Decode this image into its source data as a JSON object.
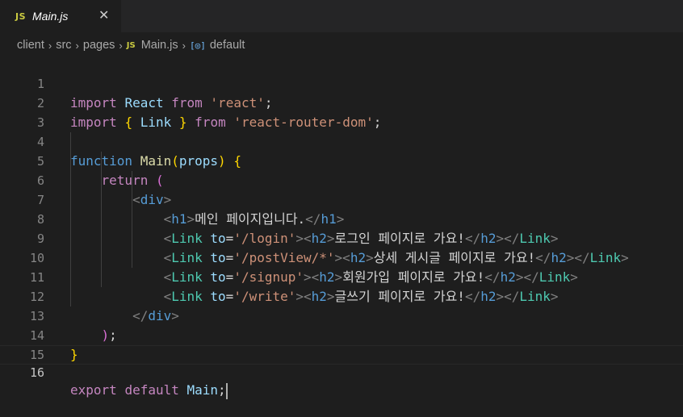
{
  "tab": {
    "badge": "JS",
    "title": "Main.js",
    "close": "✕"
  },
  "breadcrumb": {
    "items": [
      "client",
      "src",
      "pages"
    ],
    "file_badge": "JS",
    "file": "Main.js",
    "symbol_icon": "[◎]",
    "symbol": "default",
    "separator": "›"
  },
  "line_numbers": [
    "1",
    "2",
    "3",
    "4",
    "5",
    "6",
    "7",
    "8",
    "9",
    "10",
    "11",
    "12",
    "13",
    "14",
    "15",
    "16"
  ],
  "code": {
    "l1": {
      "kw": "import",
      "id": "React",
      "from": "from",
      "str": "'react'",
      "end": ";"
    },
    "l2": {
      "kw": "import",
      "ob": "{",
      "id": "Link",
      "cb": "}",
      "from": "from",
      "str": "'react-router-dom'",
      "end": ";"
    },
    "l4": {
      "kw": "function",
      "name": "Main",
      "op": "(",
      "param": "props",
      "cp": ")",
      "brace": "{"
    },
    "l5": {
      "kw": "return",
      "paren": "("
    },
    "l6": {
      "lt": "<",
      "tag": "div",
      "gt": ">"
    },
    "l7": {
      "open": "h1",
      "text": "메인 페이지입니다.",
      "close": "h1"
    },
    "l8": {
      "comp": "Link",
      "attr": "to",
      "val": "'/login'",
      "h": "h2",
      "text": "로그인 페이지로 가요!"
    },
    "l9": {
      "comp": "Link",
      "attr": "to",
      "val": "'/postView/*'",
      "h": "h2",
      "text": "상세 게시글 페이지로 가요!"
    },
    "l10": {
      "comp": "Link",
      "attr": "to",
      "val": "'/signup'",
      "h": "h2",
      "text": "회원가입 페이지로 가요!"
    },
    "l11": {
      "comp": "Link",
      "attr": "to",
      "val": "'/write'",
      "h": "h2",
      "text": "글쓰기 페이지로 가요!"
    },
    "l12": {
      "tag": "div"
    },
    "l13": {
      "paren": ")",
      "end": ";"
    },
    "l14": {
      "brace": "}"
    },
    "l16": {
      "kw": "export",
      "kw2": "default",
      "id": "Main",
      "end": ";"
    }
  }
}
